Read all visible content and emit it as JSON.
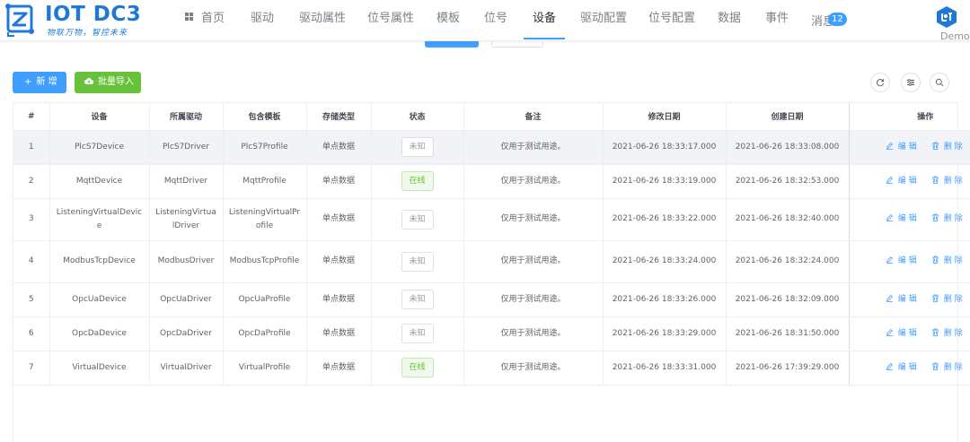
{
  "brand": {
    "title": "IOT DC3",
    "subtitle": "物联万物，智控未来"
  },
  "nav": {
    "items": [
      {
        "label": "首页",
        "icon": "grid-icon"
      },
      {
        "label": "驱动"
      },
      {
        "label": "驱动属性"
      },
      {
        "label": "位号属性"
      },
      {
        "label": "模板"
      },
      {
        "label": "位号"
      },
      {
        "label": "设备",
        "active": true
      },
      {
        "label": "驱动配置"
      },
      {
        "label": "位号配置"
      },
      {
        "label": "数据"
      },
      {
        "label": "事件"
      },
      {
        "label": "消息",
        "badge": "12"
      }
    ]
  },
  "user": {
    "name": "Demo",
    "icon": "iot-logo-icon"
  },
  "toolbar": {
    "add_label": "新 增",
    "add_icon": "+",
    "import_label": "批量导入",
    "import_icon": "cloud-upload-icon",
    "right_icons": [
      "refresh-icon",
      "sliders-icon",
      "search-icon"
    ]
  },
  "table": {
    "columns": [
      "#",
      "设备",
      "所属驱动",
      "包含模板",
      "存储类型",
      "状态",
      "备注",
      "修改日期",
      "创建日期",
      "操作"
    ],
    "rows": [
      {
        "index": "1",
        "device": "PlcS7Device",
        "driver": "PlcS7Driver",
        "profile": "PlcS7Profile",
        "storage": "单点数据",
        "status": "未知",
        "online": false,
        "remark": "仅用于测试用途。",
        "updated": "2021-06-26 18:33:17.000",
        "created": "2021-06-26 18:33:08.000"
      },
      {
        "index": "2",
        "device": "MqttDevice",
        "driver": "MqttDriver",
        "profile": "MqttProfile",
        "storage": "单点数据",
        "status": "在线",
        "online": true,
        "remark": "仅用于测试用途。",
        "updated": "2021-06-26 18:33:19.000",
        "created": "2021-06-26 18:32:53.000"
      },
      {
        "index": "3",
        "device": "ListeningVirtualDevice",
        "driver": "ListeningVirtualDriver",
        "profile": "ListeningVirtualProfile",
        "storage": "单点数据",
        "status": "未知",
        "online": false,
        "remark": "仅用于测试用途。",
        "updated": "2021-06-26 18:33:22.000",
        "created": "2021-06-26 18:32:40.000"
      },
      {
        "index": "4",
        "device": "ModbusTcpDevice",
        "driver": "ModbusDriver",
        "profile": "ModbusTcpProfile",
        "storage": "单点数据",
        "status": "未知",
        "online": false,
        "remark": "仅用于测试用途。",
        "updated": "2021-06-26 18:33:24.000",
        "created": "2021-06-26 18:32:24.000"
      },
      {
        "index": "5",
        "device": "OpcUaDevice",
        "driver": "OpcUaDriver",
        "profile": "OpcUaProfile",
        "storage": "单点数据",
        "status": "未知",
        "online": false,
        "remark": "仅用于测试用途。",
        "updated": "2021-06-26 18:33:26.000",
        "created": "2021-06-26 18:32:09.000"
      },
      {
        "index": "6",
        "device": "OpcDaDevice",
        "driver": "OpcDaDriver",
        "profile": "OpcDaProfile",
        "storage": "单点数据",
        "status": "未知",
        "online": false,
        "remark": "仅用于测试用途。",
        "updated": "2021-06-26 18:33:29.000",
        "created": "2021-06-26 18:31:50.000"
      },
      {
        "index": "7",
        "device": "VirtualDevice",
        "driver": "VirtualDriver",
        "profile": "VirtualProfile",
        "storage": "单点数据",
        "status": "在线",
        "online": true,
        "remark": "仅用于测试用途。",
        "updated": "2021-06-26 18:33:31.000",
        "created": "2021-06-26 17:39:29.000"
      }
    ],
    "actions": {
      "edit_label": "编辑",
      "edit_icon": "edit-icon",
      "delete_label": "删除",
      "delete_icon": "delete-icon"
    }
  },
  "colors": {
    "primary": "#409eff",
    "success": "#67c23a",
    "brand": "#1e78d8",
    "row_highlight": "#f2f3f6"
  }
}
